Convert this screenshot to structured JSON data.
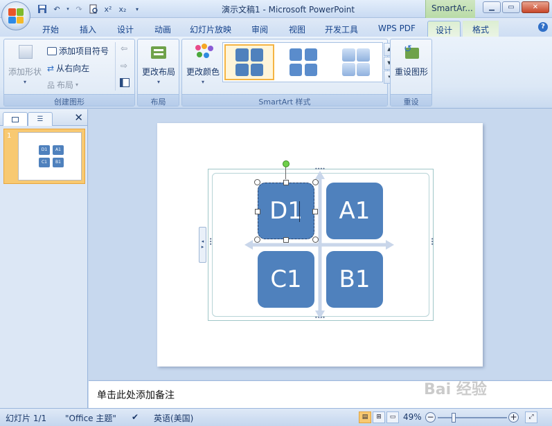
{
  "app": {
    "title": "演示文稿1 - Microsoft PowerPoint",
    "context_tab_title": "SmartAr..."
  },
  "tabs": [
    {
      "label": "开始"
    },
    {
      "label": "插入"
    },
    {
      "label": "设计"
    },
    {
      "label": "动画"
    },
    {
      "label": "幻灯片放映"
    },
    {
      "label": "审阅"
    },
    {
      "label": "视图"
    },
    {
      "label": "开发工具"
    },
    {
      "label": "WPS PDF"
    },
    {
      "label": "设计"
    },
    {
      "label": "格式"
    }
  ],
  "ribbon": {
    "create_graphic": {
      "label": "创建图形",
      "add_shape": "添加形状",
      "add_bullet": "添加项目符号",
      "right_to_left": "从右向左",
      "layout": "布局"
    },
    "layout_group": {
      "label": "布局",
      "change_layout": "更改布局"
    },
    "styles_group": {
      "label": "SmartArt 样式",
      "change_colors": "更改颜色"
    },
    "reset_group": {
      "label": "重设",
      "reset_graphic": "重设图形"
    }
  },
  "slide_panel": {
    "slide_number": "1",
    "thumb_labels": [
      "D1",
      "A1",
      "C1",
      "B1"
    ]
  },
  "smartart": {
    "boxes": [
      {
        "text": "D1",
        "selected": true
      },
      {
        "text": "A1",
        "selected": false
      },
      {
        "text": "C1",
        "selected": false
      },
      {
        "text": "B1",
        "selected": false
      }
    ],
    "color": "#4f81bd"
  },
  "notes": {
    "placeholder": "单击此处添加备注"
  },
  "status": {
    "slide_info": "幻灯片 1/1",
    "theme": "\"Office 主题\"",
    "language": "英语(美国)",
    "zoom": "49%"
  },
  "watermark": "Bai 经验"
}
